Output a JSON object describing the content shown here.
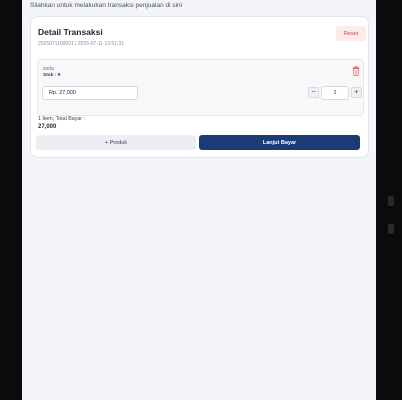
{
  "page": {
    "subtitle": "Silahkan untuk melakukan transaksi penjualan di sini"
  },
  "transaction": {
    "title": "Detail Transaksi",
    "meta": "2025071100001 | 2025-07-11 13:51:31",
    "reset_label": "Reset"
  },
  "item": {
    "name": "soda",
    "stock": "Stok : 9",
    "price": "Rp. 27,000",
    "qty_minus": "−",
    "qty": "1",
    "qty_plus": "+",
    "delete_icon": "trash-icon"
  },
  "summary": {
    "line": "1 Item, Total Bayar :",
    "total": "27,000"
  },
  "actions": {
    "produk_label": "+ Produk",
    "lanjut_label": "Lanjut Bayar"
  },
  "colors": {
    "primary": "#1d3a78",
    "danger_bg": "#fdeaea",
    "danger_fg": "#c44444"
  }
}
